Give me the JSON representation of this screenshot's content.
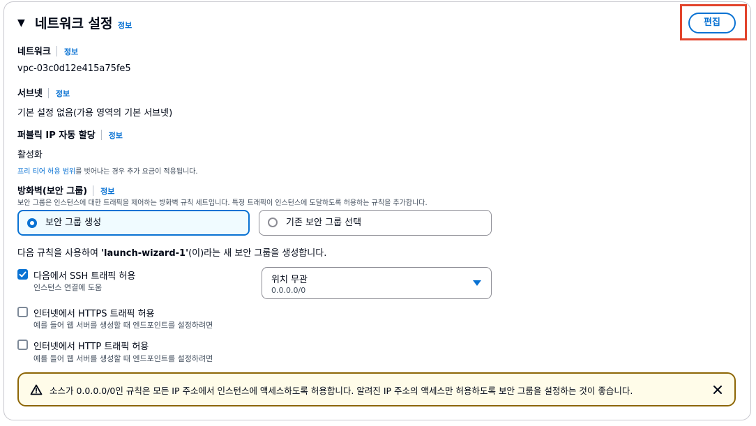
{
  "section": {
    "title": "네트워크 설정",
    "info": "정보",
    "edit_label": "편집",
    "colors": {
      "accent": "#0972d3",
      "highlight": "#e2442c",
      "warning_border": "#8d6605",
      "warning_bg": "#fffce9"
    }
  },
  "network": {
    "label": "네트워크",
    "info": "정보",
    "value": "vpc-03c0d12e415a75fe5"
  },
  "subnet": {
    "label": "서브넷",
    "info": "정보",
    "value": "기본 설정 없음(가용 영역의 기본 서브넷)"
  },
  "public_ip": {
    "label": "퍼블릭 IP 자동 할당",
    "info": "정보",
    "value": "활성화",
    "free_tier_link": "프리 티어 허용 범위",
    "free_tier_note": "를 벗어나는 경우 추가 요금이 적용됩니다."
  },
  "firewall": {
    "label": "방화벽(보안 그룹)",
    "info": "정보",
    "description": "보안 그룹은 인스턴스에 대한 트래픽을 제어하는 방화벽 규칙 세트입니다. 특정 트래픽이 인스턴스에 도달하도록 허용하는 규칙을 추가합니다.",
    "options": [
      {
        "label": "보안 그룹 생성",
        "selected": true
      },
      {
        "label": "기존 보안 그룹 선택",
        "selected": false
      }
    ],
    "rule_prefix": "다음 규칙을 사용하여 ",
    "rule_name": "'launch-wizard-1'",
    "rule_suffix": "(이)라는 새 보안 그룹을 생성합니다."
  },
  "rules": [
    {
      "label": "다음에서 SSH 트래픽 허용",
      "description": "인스턴스 연결에 도움",
      "checked": true
    },
    {
      "label": "인터넷에서 HTTPS 트래픽 허용",
      "description": "예를 들어 웹 서버를 생성할 때 엔드포인트를 설정하려면",
      "checked": false
    },
    {
      "label": "인터넷에서 HTTP 트래픽 허용",
      "description": "예를 들어 웹 서버를 생성할 때 엔드포인트를 설정하려면",
      "checked": false
    }
  ],
  "source_select": {
    "label": "위치 무관",
    "sublabel": "0.0.0.0/0"
  },
  "warning": {
    "text": "소스가 0.0.0.0/0인 규칙은 모든 IP 주소에서 인스턴스에 액세스하도록 허용합니다. 알려진 IP 주소의 액세스만 허용하도록 보안 그룹을 설정하는 것이 좋습니다."
  }
}
